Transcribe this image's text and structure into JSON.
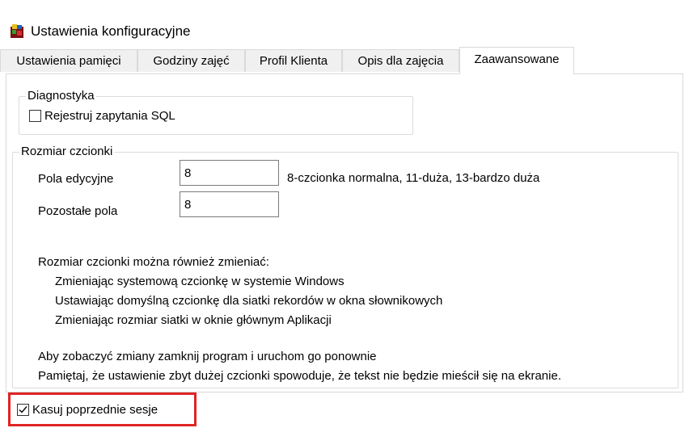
{
  "window": {
    "title": "Ustawienia konfiguracyjne",
    "icon": "app-icon"
  },
  "tabs": [
    {
      "label": "Ustawienia pamięci",
      "active": false
    },
    {
      "label": "Godziny zajęć",
      "active": false
    },
    {
      "label": "Profil Klienta",
      "active": false
    },
    {
      "label": "Opis dla zajęcia",
      "active": false
    },
    {
      "label": "Zaawansowane",
      "active": true
    }
  ],
  "diagnostics": {
    "legend": "Diagnostyka",
    "log_sql": {
      "label": "Rejestruj zapytania SQL",
      "checked": false
    }
  },
  "font_size": {
    "legend": "Rozmiar czcionki",
    "edit_fields": {
      "label": "Pola edycyjne",
      "value": "8"
    },
    "other_fields": {
      "label": "Pozostałe pola",
      "value": "8"
    },
    "hint": "8-czcionka normalna, 11-duża, 13-bardzo duża",
    "info_heading": "Rozmiar czcionki można również zmieniać:",
    "info_lines": [
      "Zmieniając systemową czcionkę w systemie Windows",
      "Ustawiając domyślną czcionkę dla siatki rekordów w okna słownikowych",
      "Zmieniając rozmiar siatki w oknie głównym Aplikacji"
    ],
    "restart_note": "Aby zobaczyć zmiany zamknij program i uruchom go ponownie",
    "warning_note": "Pamiętaj, że ustawienie zbyt dużej czcionki spowoduje, że tekst nie będzie mieścił się na ekranie."
  },
  "clear_sessions": {
    "label": "Kasuj poprzednie sesje",
    "checked": true
  },
  "colors": {
    "highlight": "#e02424",
    "border": "#d9d9d9",
    "tab_bg": "#f0f0f0"
  }
}
